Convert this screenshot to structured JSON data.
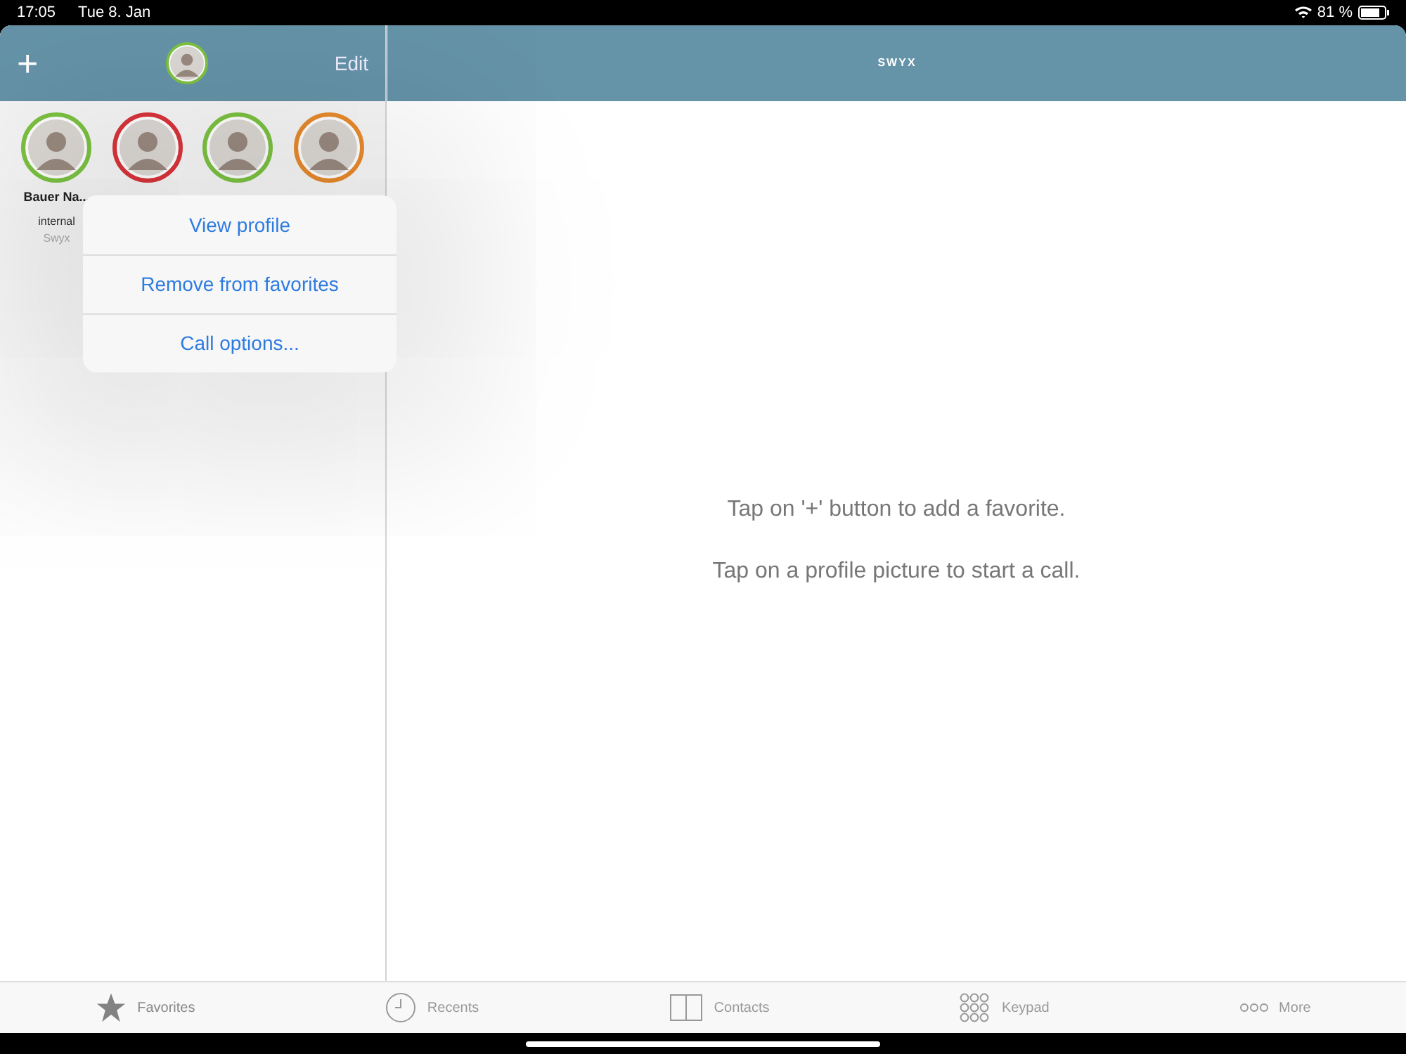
{
  "status_bar": {
    "time": "17:05",
    "date": "Tue 8. Jan",
    "battery": "81 %"
  },
  "sidebar": {
    "add": "+",
    "edit": "Edit",
    "favorites": [
      {
        "name": "Bauer Na...",
        "subtitle": "internal",
        "source": "Swyx",
        "color": "#7cc242"
      },
      {
        "color": "#d9343a"
      },
      {
        "color": "#7cc242"
      },
      {
        "color": "#e88a2c"
      }
    ]
  },
  "menu": [
    "View profile",
    "Remove from favorites",
    "Call options..."
  ],
  "header": {
    "logo": "SWYX"
  },
  "hints": [
    "Tap on '+' button to add a favorite.",
    "Tap on a profile picture to start a call."
  ],
  "tabs": [
    {
      "label": "Favorites",
      "kind": "star",
      "selected": true
    },
    {
      "label": "Recents",
      "kind": "clock",
      "selected": false
    },
    {
      "label": "Contacts",
      "kind": "book",
      "selected": false
    },
    {
      "label": "Keypad",
      "kind": "keypad",
      "selected": false
    },
    {
      "label": "More",
      "kind": "more",
      "selected": false
    }
  ]
}
